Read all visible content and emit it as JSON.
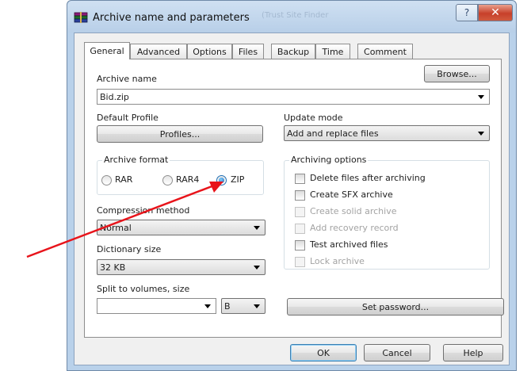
{
  "window": {
    "title": "Archive name and parameters",
    "title_faded": "(Trust Site Finder",
    "help_glyph": "?",
    "close_glyph": "✕"
  },
  "tabs": [
    {
      "label": "General",
      "active": true
    },
    {
      "label": "Advanced"
    },
    {
      "label": "Options"
    },
    {
      "label": "Files"
    },
    {
      "label": "Backup"
    },
    {
      "label": "Time"
    },
    {
      "label": "Comment"
    }
  ],
  "general": {
    "archive_name_label": "Archive name",
    "archive_name_value": "Bid.zip",
    "browse_label": "Browse...",
    "default_profile_label": "Default Profile",
    "profiles_label": "Profiles...",
    "update_mode_label": "Update mode",
    "update_mode_value": "Add and replace files",
    "archive_format": {
      "title": "Archive format",
      "options": [
        "RAR",
        "RAR4",
        "ZIP"
      ],
      "selected": "ZIP"
    },
    "compression_method_label": "Compression method",
    "compression_method_value": "Normal",
    "dictionary_size_label": "Dictionary size",
    "dictionary_size_value": "32 KB",
    "split_label": "Split to volumes, size",
    "split_value": "",
    "split_unit": "B",
    "archiving_options": {
      "title": "Archiving options",
      "items": [
        {
          "label": "Delete files after archiving",
          "checked": false,
          "enabled": true
        },
        {
          "label": "Create SFX archive",
          "checked": false,
          "enabled": true
        },
        {
          "label": "Create solid archive",
          "checked": false,
          "enabled": false
        },
        {
          "label": "Add recovery record",
          "checked": false,
          "enabled": false
        },
        {
          "label": "Test archived files",
          "checked": false,
          "enabled": true
        },
        {
          "label": "Lock archive",
          "checked": false,
          "enabled": false
        }
      ]
    },
    "set_password_label": "Set password..."
  },
  "footer": {
    "ok_label": "OK",
    "cancel_label": "Cancel",
    "help_label": "Help"
  },
  "colors": {
    "annotation_arrow": "#e8141b",
    "window_frame": "#b9d1ea"
  }
}
